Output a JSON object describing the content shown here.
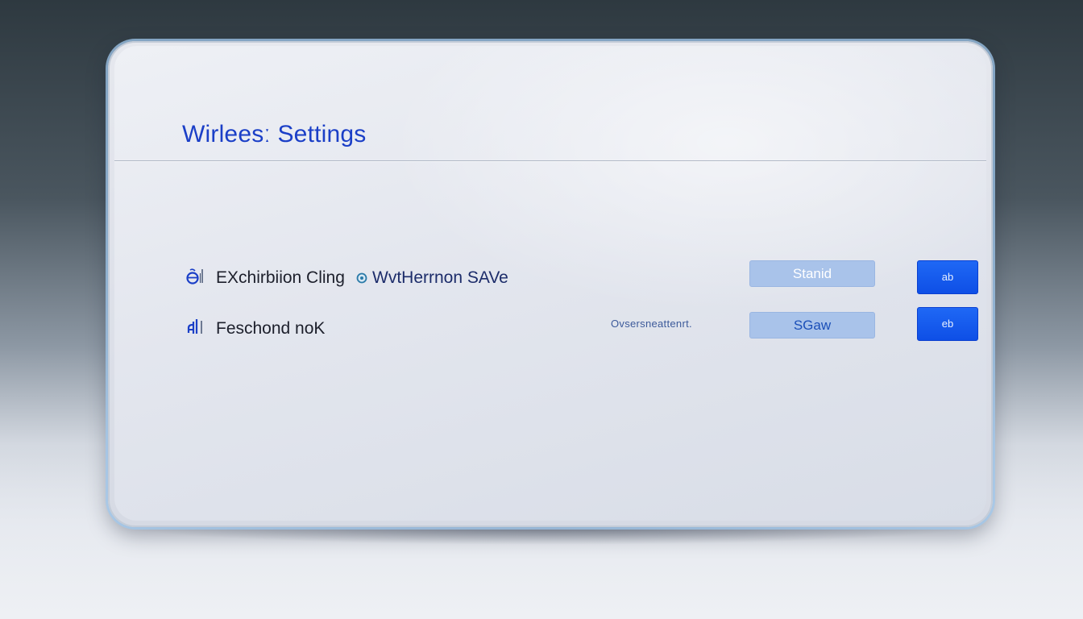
{
  "header": {
    "title": "Wirleesː Settings"
  },
  "settings": {
    "rows": [
      {
        "icon": "wifi-signal-icon",
        "label": "EXchirbiion Cling",
        "badge_icon": "info-badge-icon",
        "link_text": "WvtHerrnon SAVe",
        "hint": "",
        "field_value": "Stanid",
        "button_label": "ab"
      },
      {
        "icon": "signal-bars-icon",
        "label": "Feschond noK",
        "hint": "Ovsersneattenrt.",
        "field_value": "SGaw",
        "button_label": "eb"
      }
    ]
  },
  "colors": {
    "title": "#1b3fc7",
    "field_background": "#a9c3ea",
    "button_background": "#1f68f5",
    "device_outline_glow": "#a0c8ee"
  }
}
